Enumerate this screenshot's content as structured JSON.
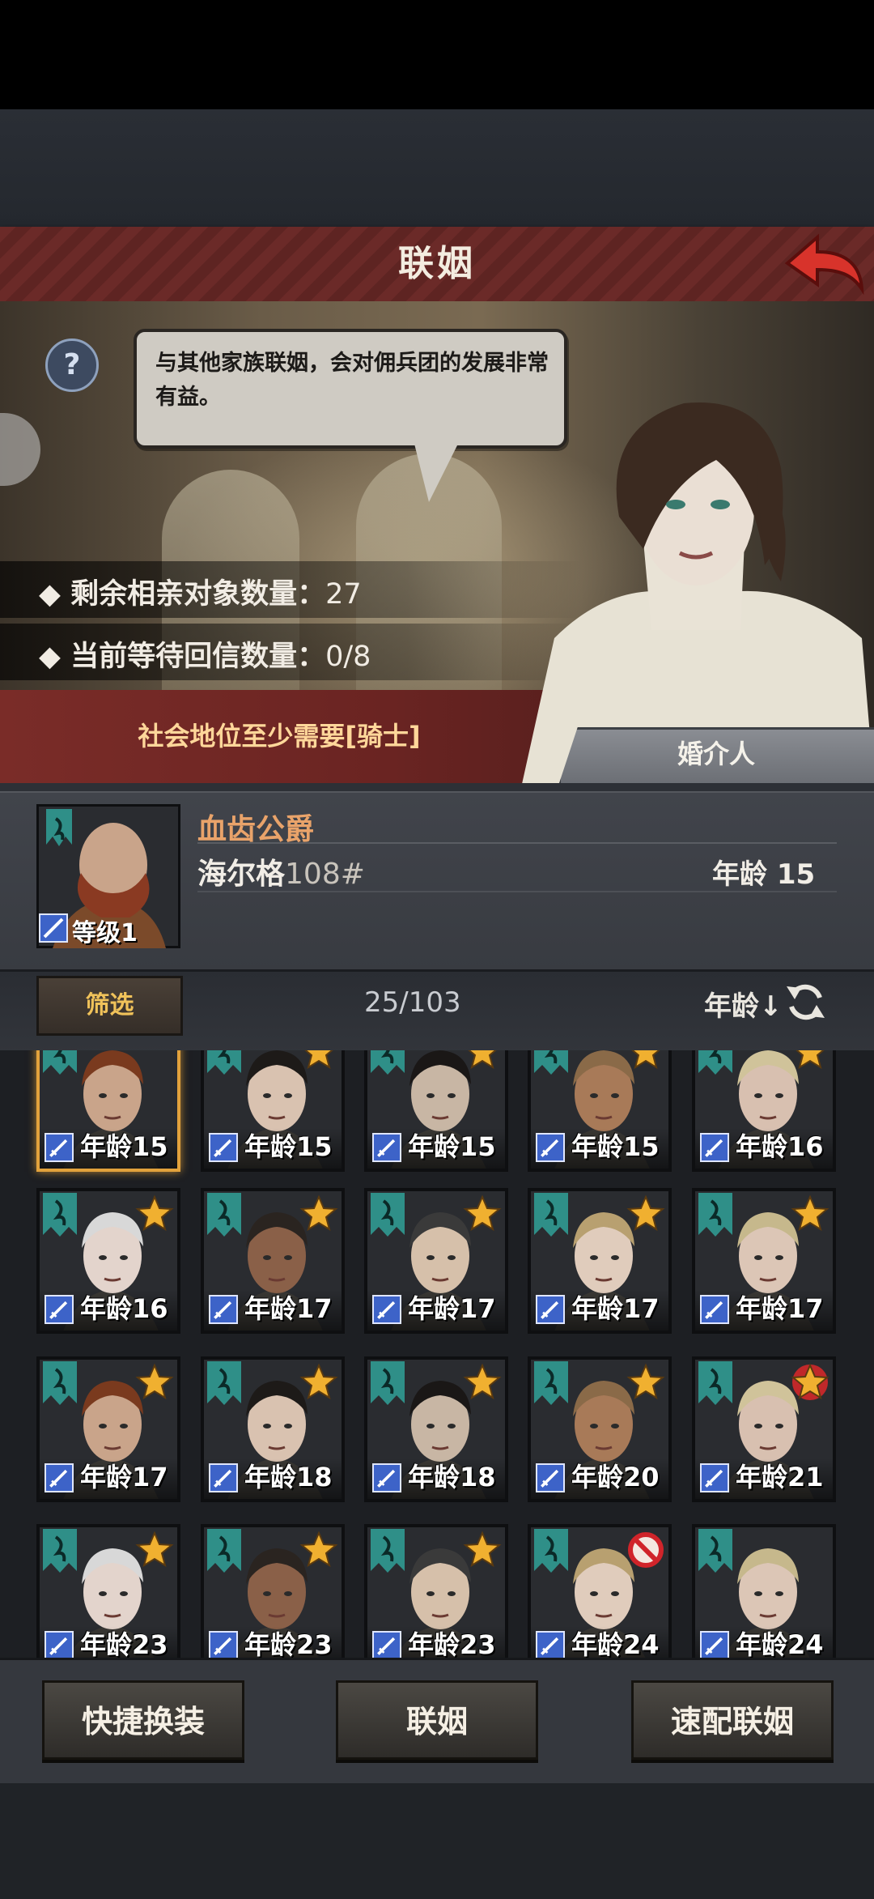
{
  "header": {
    "title": "联姻"
  },
  "dialog": {
    "text": "与其他家族联姻，会对佣兵团的发展非常有益。"
  },
  "stats": {
    "remaining_label": "剩余相亲对象数量：",
    "remaining_value": "27",
    "waiting_label": "当前等待回信数量：",
    "waiting_value": "0/8"
  },
  "requirement": "社会地位至少需要[骑士]",
  "matchmaker_label": "婚介人",
  "selected": {
    "title": "血齿公爵",
    "name": "海尔格",
    "id": "108#",
    "level_label": "等级1",
    "age_label": "年龄 15"
  },
  "filter": {
    "button": "筛选",
    "count": "25/103",
    "sort_label": "年龄↓"
  },
  "candidates": [
    {
      "age": "年龄15",
      "star": "none"
    },
    {
      "age": "年龄15",
      "star": "gold"
    },
    {
      "age": "年龄15",
      "star": "gold"
    },
    {
      "age": "年龄15",
      "star": "gold"
    },
    {
      "age": "年龄16",
      "star": "gold"
    },
    {
      "age": "年龄16",
      "star": "gold"
    },
    {
      "age": "年龄17",
      "star": "gold"
    },
    {
      "age": "年龄17",
      "star": "gold"
    },
    {
      "age": "年龄17",
      "star": "gold"
    },
    {
      "age": "年龄17",
      "star": "gold"
    },
    {
      "age": "年龄17",
      "star": "gold"
    },
    {
      "age": "年龄18",
      "star": "gold"
    },
    {
      "age": "年龄18",
      "star": "gold"
    },
    {
      "age": "年龄20",
      "star": "gold"
    },
    {
      "age": "年龄21",
      "star": "red"
    },
    {
      "age": "年龄23",
      "star": "gold"
    },
    {
      "age": "年龄23",
      "star": "gold"
    },
    {
      "age": "年龄23",
      "star": "gold"
    },
    {
      "age": "年龄24",
      "star": "forbidden"
    },
    {
      "age": "年龄24",
      "star": "none"
    }
  ],
  "actions": {
    "quick_change": "快捷换装",
    "marry": "联姻",
    "quick_match": "速配联姻"
  },
  "colors": {
    "title_red": "#6b2a28",
    "accent_orange": "#e9a36a",
    "gold": "#f0c25a",
    "teal_emblem": "#2f8f88"
  }
}
